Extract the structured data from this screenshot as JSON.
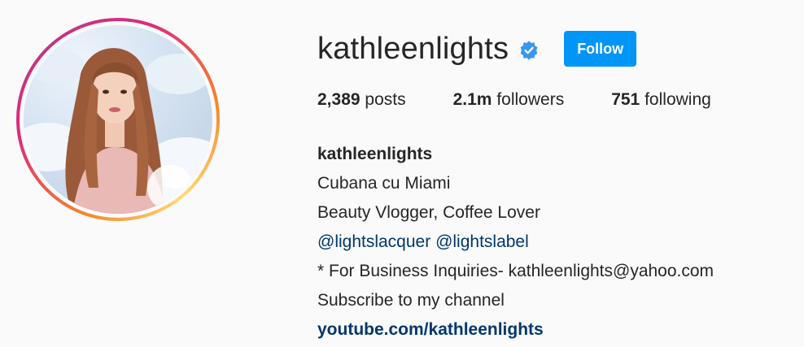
{
  "profile": {
    "username": "kathleenlights",
    "verified": true,
    "follow_label": "Follow",
    "accent_color": "#0095f6"
  },
  "stats": {
    "posts_count": "2,389",
    "posts_label": "posts",
    "followers_count": "2.1m",
    "followers_label": "followers",
    "following_count": "751",
    "following_label": "following"
  },
  "bio": {
    "full_name": "kathleenlights",
    "line1": "Cubana cu Miami",
    "line2": "Beauty Vlogger, Coffee Lover",
    "mention1": "@lightslacquer",
    "mention2": "@lightslabel",
    "line4": "* For Business Inquiries- kathleenlights@yahoo.com",
    "line5": "Subscribe to my channel",
    "website": "youtube.com/kathleenlights"
  }
}
